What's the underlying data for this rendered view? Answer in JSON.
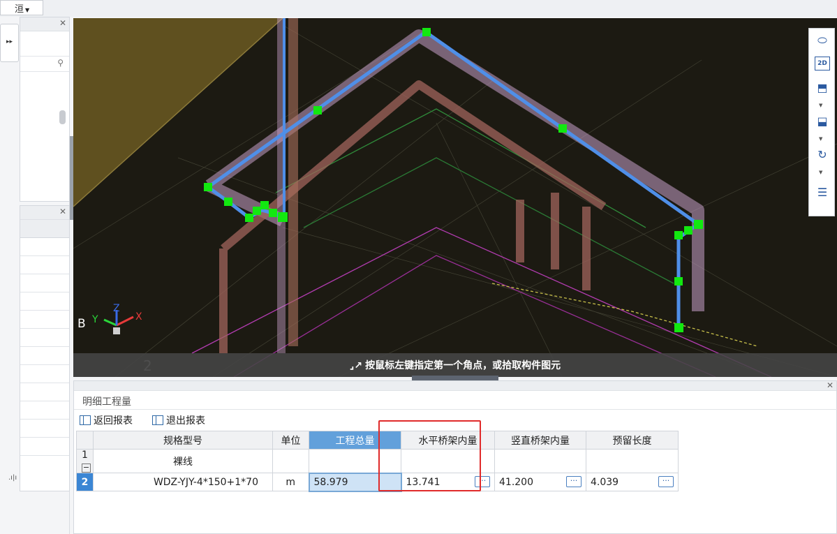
{
  "top": {
    "dropdown_label": "洹"
  },
  "left_panel": {
    "toggle_glyph": "▸▸",
    "grip_glyph": ".ı|ı"
  },
  "viewport": {
    "tip_text": "按鼠标左键指定第一个角点，或拾取构件图元",
    "floor_label": "2",
    "axis": {
      "b": "B",
      "x": "X",
      "y": "Y",
      "z": "Z"
    },
    "toolbar": [
      "orbit-icon",
      "2d-view-icon",
      "3d-box-icon",
      "3d-solid-icon",
      "rotate-icon",
      "layer-display-icon"
    ],
    "toolbar_2d_label": "2D",
    "colors": {
      "highlight_path": "#4f8fe8",
      "node": "#12e810",
      "tray": "#c7a0c9",
      "background": "#1c1a12"
    }
  },
  "bottom_panel": {
    "title": "明细工程量",
    "buttons": {
      "return": "返回报表",
      "exit": "退出报表"
    },
    "table": {
      "headers": [
        "规格型号",
        "单位",
        "工程总量",
        "水平桥架内量",
        "竖直桥架内量",
        "预留长度"
      ],
      "rows": [
        {
          "num": "1",
          "expander": "−",
          "spec": "裸线",
          "unit": "",
          "total": "",
          "horizontal": "",
          "vertical": "",
          "reserve": ""
        },
        {
          "num": "2",
          "spec": "WDZ-YJY-4*150+1*70",
          "unit": "m",
          "total": "58.979",
          "horizontal": "13.741",
          "vertical": "41.200",
          "reserve": "4.039"
        }
      ],
      "ellipsis": "···"
    }
  }
}
